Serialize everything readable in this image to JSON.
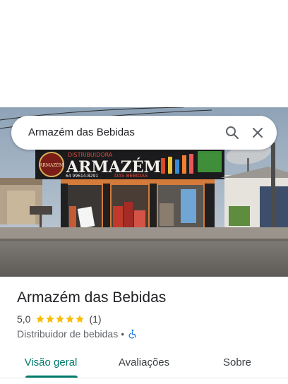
{
  "search": {
    "query": "Armazém das Bebidas",
    "search_icon": "search-icon",
    "close_icon": "close-icon"
  },
  "photo": {
    "sign_top": "DISTRIBUIDORA",
    "sign_main": "ARMAZÉM",
    "sign_sub": "DAS BEBIDAS",
    "sign_phone": "64 99614-8291",
    "logo_text": "ARMAZÉM"
  },
  "place": {
    "title": "Armazém das Bebidas",
    "rating": "5,0",
    "stars": 5,
    "review_count": "(1)",
    "category": "Distribuidor de bebidas",
    "separator": "•",
    "accessibility_icon": "wheelchair-icon"
  },
  "tabs": [
    {
      "label": "Visão geral",
      "active": true
    },
    {
      "label": "Avaliações",
      "active": false
    },
    {
      "label": "Sobre",
      "active": false
    }
  ],
  "colors": {
    "accent": "#00796b",
    "star": "#fbbc04",
    "accessibility": "#1a73e8"
  }
}
